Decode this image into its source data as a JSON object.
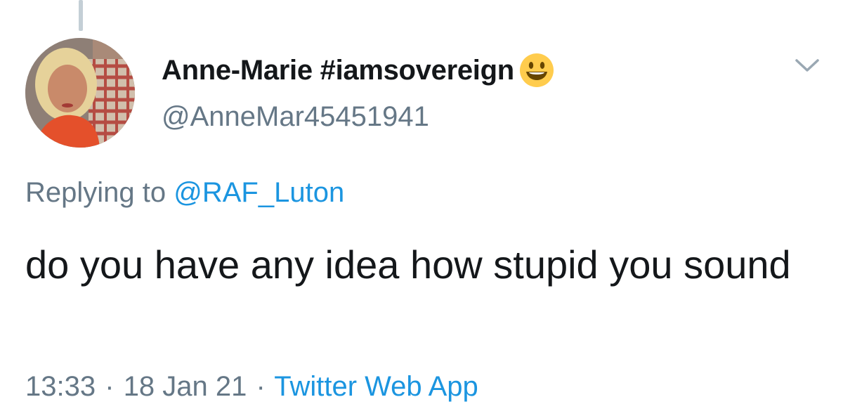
{
  "tweet": {
    "author": {
      "display_name": "Anne-Marie #iamsovereign",
      "emoji": "smiley-face-emoji",
      "handle": "@AnneMar45451941"
    },
    "replying_to": {
      "prefix": "Replying to",
      "mention": "@RAF_Luton"
    },
    "text": "do you have any idea how stupid you sound",
    "meta": {
      "time": "13:33",
      "separator": "·",
      "date": "18 Jan 21",
      "source": "Twitter Web App"
    },
    "icons": {
      "more": "chevron-down-icon"
    },
    "colors": {
      "text": "#14171a",
      "secondary": "#657786",
      "link": "#1b95e0",
      "thread_line": "#c4cfd6"
    }
  }
}
